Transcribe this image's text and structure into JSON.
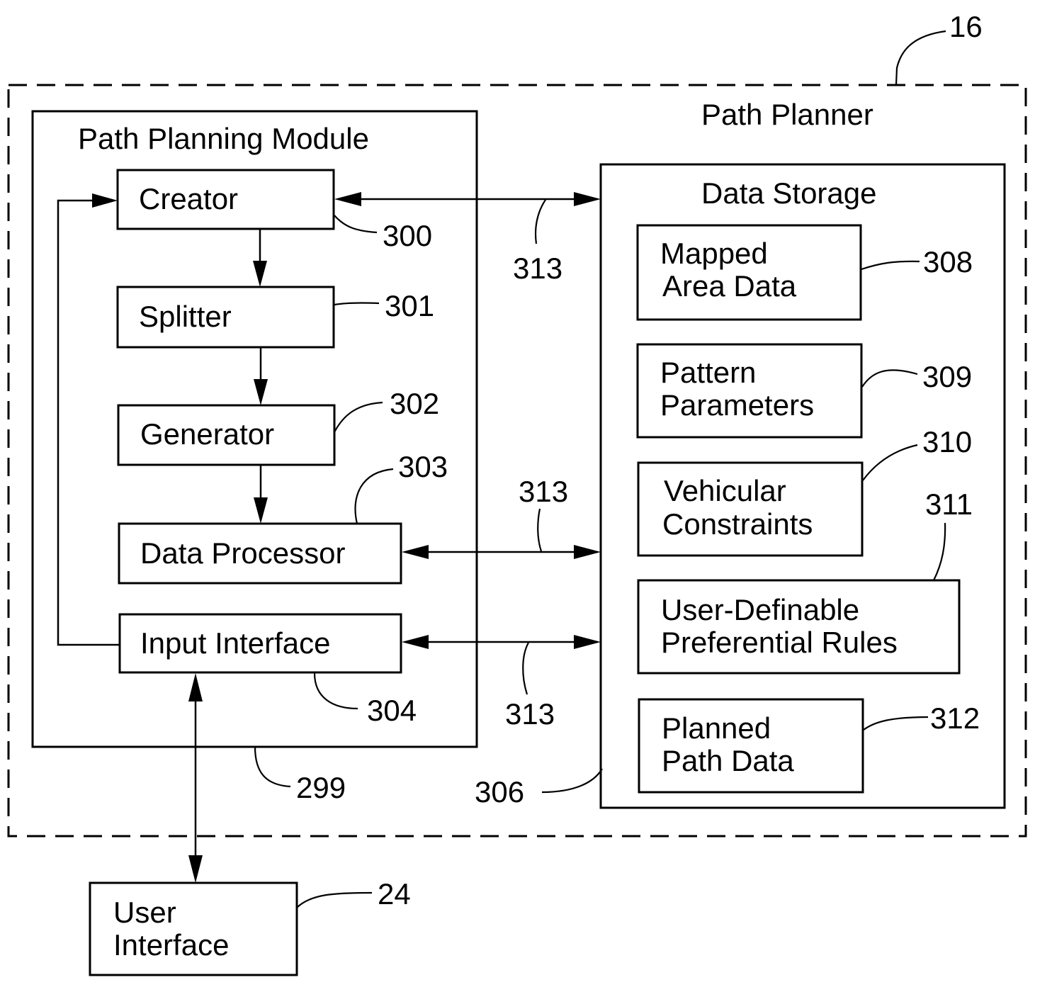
{
  "diagram": {
    "outer": {
      "title": "Path Planner",
      "ref": "16"
    },
    "module": {
      "title": "Path Planning Module",
      "ref": "299"
    },
    "components": {
      "creator": {
        "label": "Creator",
        "ref": "300"
      },
      "splitter": {
        "label": "Splitter",
        "ref": "301"
      },
      "generator": {
        "label": "Generator",
        "ref": "302"
      },
      "data_processor": {
        "label": "Data Processor",
        "ref": "303"
      },
      "input_interface": {
        "label": "Input Interface",
        "ref": "304"
      }
    },
    "storage": {
      "title": "Data Storage",
      "ref": "306",
      "items": [
        {
          "line1": "Mapped",
          "line2": "Area Data",
          "ref": "308"
        },
        {
          "line1": "Pattern",
          "line2": "Parameters",
          "ref": "309"
        },
        {
          "line1": "Vehicular",
          "line2": "Constraints",
          "ref": "310"
        },
        {
          "line1": "User-Definable",
          "line2": "Preferential Rules",
          "ref": "311"
        },
        {
          "line1": "Planned",
          "line2": "Path Data",
          "ref": "312"
        }
      ]
    },
    "links": [
      {
        "ref": "313"
      },
      {
        "ref": "313"
      },
      {
        "ref": "313"
      }
    ],
    "user_interface": {
      "line1": "User",
      "line2": "Interface",
      "ref": "24"
    }
  }
}
